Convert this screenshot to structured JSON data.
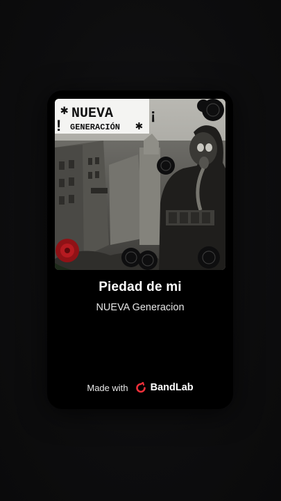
{
  "track": {
    "title": "Piedad de mi",
    "artist": "NUEVA Generacion"
  },
  "cover_art": {
    "text_line1": "NUEVA",
    "text_line2": "GENERACIÓN",
    "exclamation_open": "¡",
    "exclamation_close": "!"
  },
  "footer": {
    "made_with": "Made with",
    "brand": "BandLab",
    "brand_icon": "bandlab-logo-icon",
    "brand_color": "#f0303a"
  },
  "colors": {
    "background": "#0e0e0f",
    "card": "#000000",
    "text_primary": "#ffffff"
  }
}
